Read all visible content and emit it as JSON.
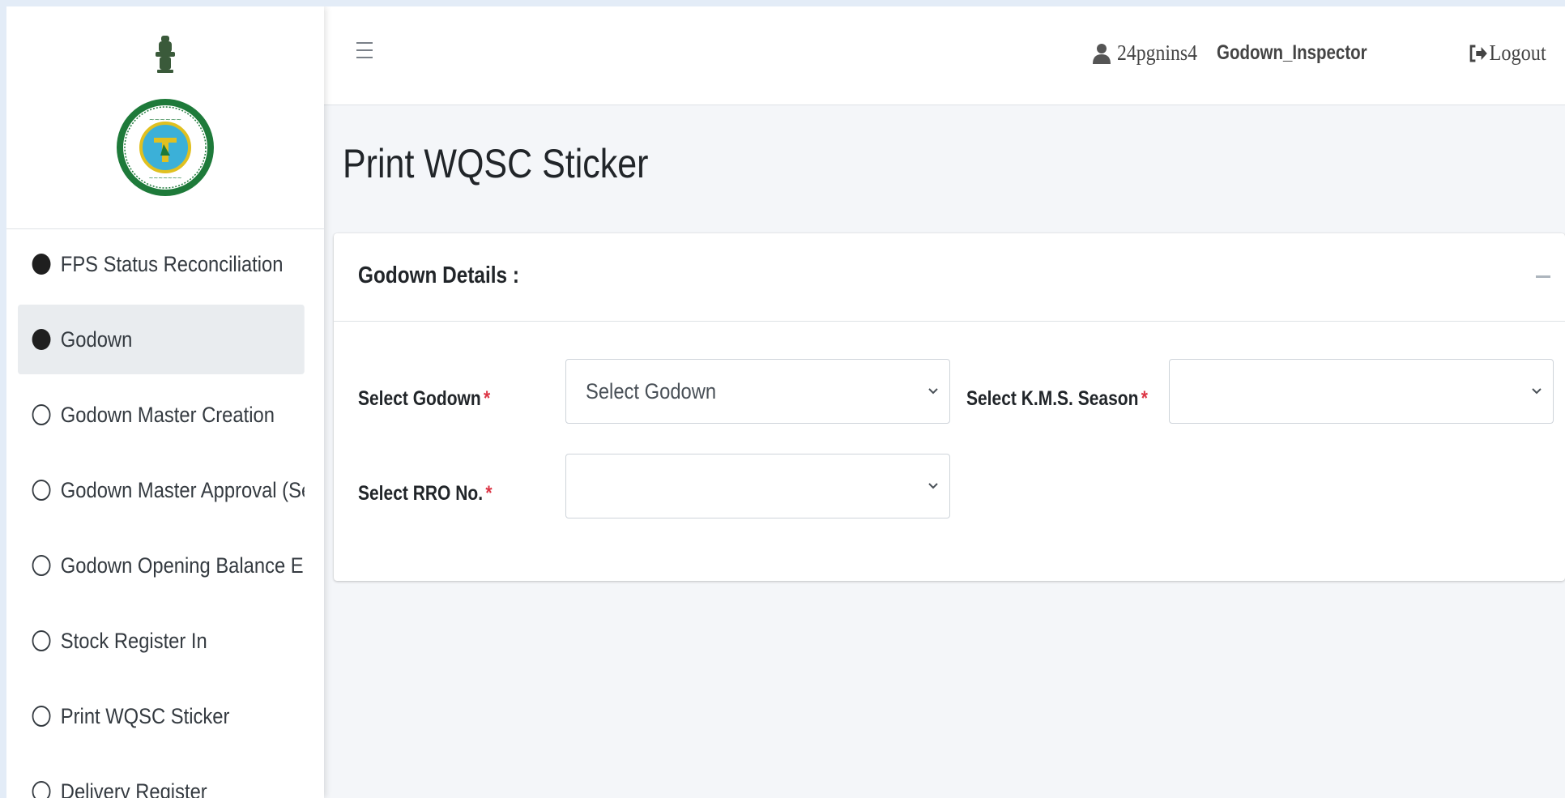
{
  "header": {
    "user_name": "24pgnins4",
    "user_role": "Godown_Inspector",
    "logout_label": "Logout"
  },
  "sidebar": {
    "items": [
      {
        "label": "FPS Status Reconciliation",
        "icon": "filled-circle-icon"
      },
      {
        "label": "Godown",
        "icon": "filled-circle-icon",
        "active": true
      },
      {
        "label": "Godown Master Creation",
        "icon": "empty-circle-icon"
      },
      {
        "label": "Godown Master Approval (Se",
        "icon": "empty-circle-icon"
      },
      {
        "label": "Godown Opening Balance Er",
        "icon": "empty-circle-icon"
      },
      {
        "label": "Stock Register In",
        "icon": "empty-circle-icon"
      },
      {
        "label": "Print WQSC Sticker",
        "icon": "empty-circle-icon"
      },
      {
        "label": "Delivery Register",
        "icon": "empty-circle-icon"
      }
    ]
  },
  "page": {
    "title": "Print WQSC Sticker"
  },
  "card": {
    "title": "Godown Details :",
    "fields": {
      "godown": {
        "label": "Select Godown",
        "value": "Select Godown"
      },
      "season": {
        "label": "Select K.M.S. Season",
        "value": ""
      },
      "rro": {
        "label": "Select RRO No.",
        "value": ""
      }
    },
    "required_mark": "*"
  },
  "colors": {
    "accent_required": "#dc3545",
    "active_item_bg": "#e9ecef",
    "emblem_green": "#1e7a3a"
  }
}
